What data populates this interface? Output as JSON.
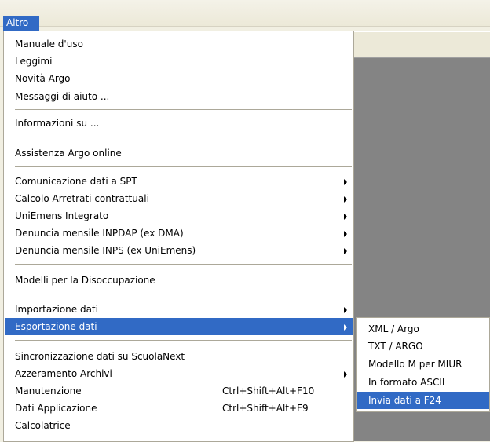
{
  "menubar": {
    "active_menu": "Altro"
  },
  "menu": {
    "items": [
      {
        "label": "Manuale d'uso"
      },
      {
        "label": "Leggimi"
      },
      {
        "label": "Novità Argo"
      },
      {
        "label": "Messaggi di aiuto ..."
      },
      {
        "label": "Informazioni su ..."
      },
      {
        "label": "Assistenza Argo online"
      },
      {
        "label": "Comunicazione dati a SPT"
      },
      {
        "label": "Calcolo Arretrati contrattuali"
      },
      {
        "label": "UniEmens Integrato"
      },
      {
        "label": "Denuncia mensile INPDAP (ex DMA)"
      },
      {
        "label": "Denuncia mensile INPS (ex UniEmens)"
      },
      {
        "label": "Modelli per la Disoccupazione"
      },
      {
        "label": "Importazione dati"
      },
      {
        "label": "Esportazione dati"
      },
      {
        "label": "Sincronizzazione dati su ScuolaNext"
      },
      {
        "label": "Azzeramento Archivi"
      },
      {
        "label": "Manutenzione",
        "shortcut": "Ctrl+Shift+Alt+F10"
      },
      {
        "label": "Dati Applicazione",
        "shortcut": "Ctrl+Shift+Alt+F9"
      },
      {
        "label": "Calcolatrice"
      }
    ]
  },
  "submenu": {
    "items": [
      {
        "label": "XML / Argo"
      },
      {
        "label": "TXT / ARGO"
      },
      {
        "label": "Modello M per MIUR"
      },
      {
        "label": "In formato ASCII"
      },
      {
        "label": "Invia dati a F24"
      }
    ]
  },
  "colors": {
    "highlight": "#316ac5",
    "menu_bg": "#ffffff",
    "window_bg": "#848484"
  }
}
